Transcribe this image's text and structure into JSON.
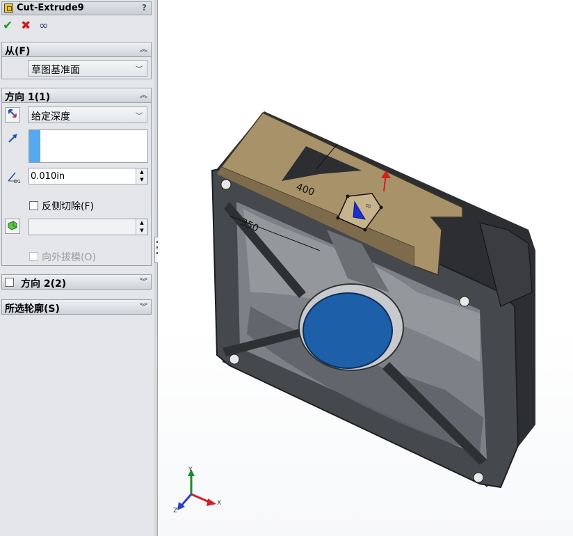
{
  "panel": {
    "title": "Cut-Extrude9",
    "help": "?",
    "actions": {
      "ok": "✔",
      "cancel": "✖",
      "preview": "∞"
    },
    "from": {
      "header": "从(F)",
      "value": "草图基准面"
    },
    "direction1": {
      "header": "方向 1(1)",
      "end_condition": "给定深度",
      "depth": "0.010in",
      "flip_side_label": "反侧切除(F)",
      "draft_outward_label": "向外拔模(O)"
    },
    "direction2": {
      "header": "方向 2(2)"
    },
    "contours": {
      "header": "所选轮廓(S)"
    }
  },
  "viewport": {
    "dimensions": [
      "400",
      "350",
      "8"
    ],
    "triad": {
      "x": "X",
      "y": "Y",
      "z": "Z"
    },
    "colors": {
      "hub": "#1d5fa8",
      "sketch_plate": "#a8926a",
      "fan_body": "#3e4044",
      "x_axis": "#d0202a",
      "y_axis": "#1a8a2a",
      "z_axis": "#2a3ec8"
    }
  }
}
